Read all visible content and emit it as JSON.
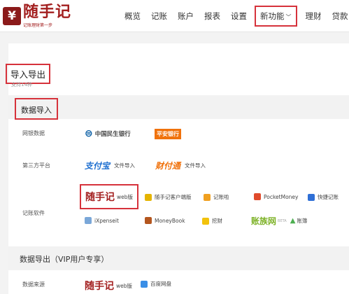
{
  "header": {
    "logo_mark": "¥",
    "logo_name": "随手记",
    "logo_slogan": "记账理财第一步",
    "nav": [
      {
        "label": "概览"
      },
      {
        "label": "记账"
      },
      {
        "label": "账户"
      },
      {
        "label": "报表"
      },
      {
        "label": "设置"
      },
      {
        "label": "新功能",
        "chevron": "﹀"
      },
      {
        "label": "理财"
      },
      {
        "label": "贷款"
      }
    ]
  },
  "page": {
    "title": "导入导出",
    "subtitle": "支持14种"
  },
  "import_section": {
    "title": "数据导入",
    "rows": {
      "online_bank": {
        "label": "网银数据",
        "cmbc": "中国民生银行",
        "pingan": "平安银行"
      },
      "third_party": {
        "label": "第三方平台",
        "alipay_logo": "支付宝",
        "alipay_text": "文件导入",
        "tenpay_logo": "财付通",
        "tenpay_text": "文件导入"
      },
      "software": {
        "label": "记账软件",
        "ssj_logo": "随手记",
        "ssj_text": "web版",
        "client": "随手记客户端版",
        "jizhangji": "记账啦",
        "pocketmoney": "PocketMoney",
        "kuaijie": "快捷记账",
        "ixpenseit": "iXpenseit",
        "moneybook": "MoneyBook",
        "wajue": "挖财",
        "zbw_logo": "账族网",
        "zbw_beta": "BETA",
        "zbw_text": "账簿"
      }
    }
  },
  "export_section": {
    "title": "数据导出（VIP用户专享）",
    "rows": {
      "source": {
        "label": "数据来源",
        "ssj_logo": "随手记",
        "ssj_text": "web版",
        "baidu": "百度网盘"
      }
    }
  },
  "colors": {
    "brand_red": "#a32020",
    "highlight_red": "#d6323b"
  }
}
